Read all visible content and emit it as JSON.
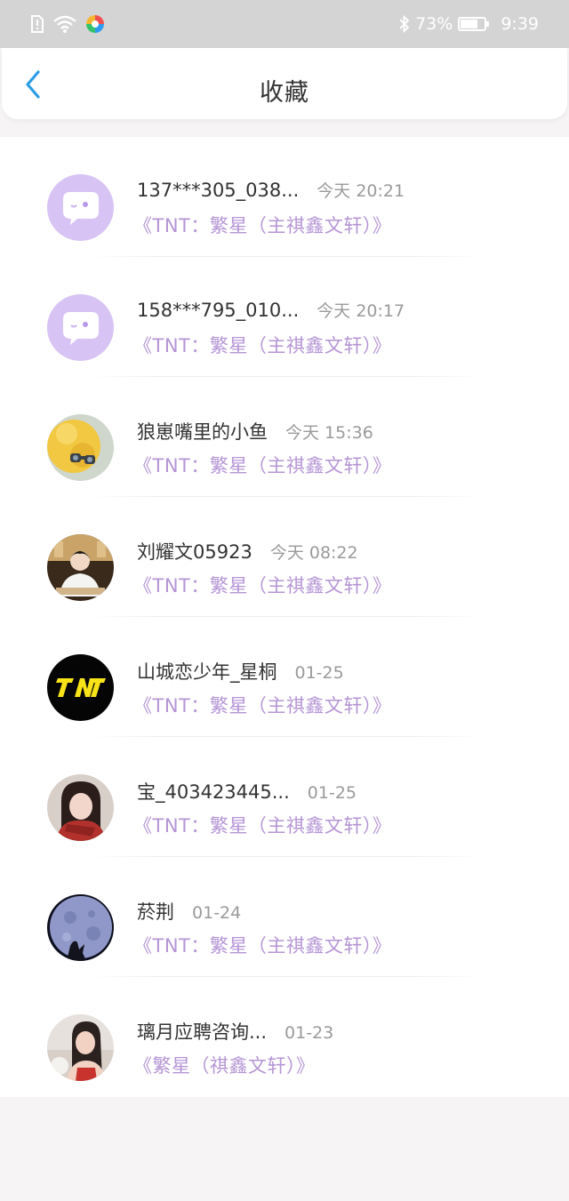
{
  "status_bar": {
    "battery_percent": "73%",
    "time": "9:39",
    "battery_level": 0.73
  },
  "header": {
    "title": "收藏"
  },
  "items": [
    {
      "name": "137***305_038...",
      "time": "今天 20:21",
      "title": "《TNT：繁星（主祺鑫文轩）》",
      "avatar": "chat-bubble-avatar"
    },
    {
      "name": "158***795_010...",
      "time": "今天 20:17",
      "title": "《TNT：繁星（主祺鑫文轩）》",
      "avatar": "chat-bubble-avatar"
    },
    {
      "name": "狼崽嘴里的小鱼",
      "time": "今天 15:36",
      "title": "《TNT：繁星（主祺鑫文轩）》",
      "avatar": "yellow-bird-photo"
    },
    {
      "name": "刘耀文05923",
      "time": "今天 08:22",
      "title": "《TNT：繁星（主祺鑫文轩）》",
      "avatar": "boy-photo"
    },
    {
      "name": "山城恋少年_星桐",
      "time": "01-25",
      "title": "《TNT：繁星（主祺鑫文轩）》",
      "avatar": "tnt-logo"
    },
    {
      "name": "宝_403423445...",
      "time": "01-25",
      "title": "《TNT：繁星（主祺鑫文轩）》",
      "avatar": "girl-red-scarf-photo"
    },
    {
      "name": "菸荆",
      "time": "01-24",
      "title": "《TNT：繁星（主祺鑫文轩）》",
      "avatar": "moon-photo"
    },
    {
      "name": "璃月应聘咨询...",
      "time": "01-23",
      "title": "《繁星（祺鑫文轩）》",
      "avatar": "girl-photo"
    }
  ],
  "colors": {
    "accent_blue": "#2a9ee6",
    "subtitle_purple": "#b595d6",
    "avatar_lilac": "#d8c4f4"
  }
}
